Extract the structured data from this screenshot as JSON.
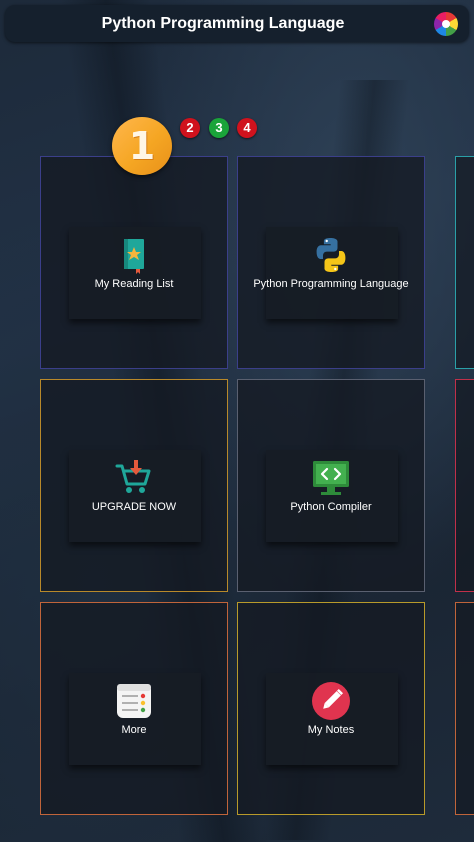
{
  "app": {
    "title": "Python Programming Language",
    "theme_icon": "color-wheel-icon"
  },
  "pager": {
    "current_page": "1",
    "pages": [
      "2",
      "3",
      "4"
    ],
    "colors": {
      "current": "#f5a623",
      "page2": "#d0121d",
      "page3": "#1aa43a",
      "page4": "#d0121d"
    }
  },
  "tiles": [
    {
      "label": "My Reading List",
      "icon": "reading-list-icon",
      "border_color": "#3b3f8a"
    },
    {
      "label": "Python Programming Language",
      "icon": "python-logo-icon",
      "border_color": "#3b3f8a"
    },
    {
      "label": "UPGRADE NOW",
      "icon": "shopping-cart-icon",
      "border_color": "#b8892a"
    },
    {
      "label": "Python Compiler",
      "icon": "code-monitor-icon",
      "border_color": "#5a6070"
    },
    {
      "label": "More",
      "icon": "list-menu-icon",
      "border_color": "#c0643a"
    },
    {
      "label": "My Notes",
      "icon": "pencil-icon",
      "border_color": "#b89a2a"
    }
  ]
}
